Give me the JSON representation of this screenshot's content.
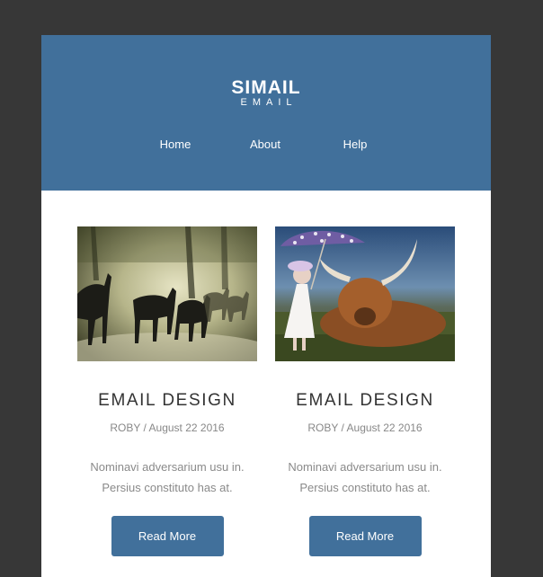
{
  "brand": {
    "title": "SIMAIL",
    "subtitle": "EMAIL"
  },
  "nav": [
    {
      "label": "Home"
    },
    {
      "label": "About"
    },
    {
      "label": "Help"
    }
  ],
  "posts": [
    {
      "image": "horses-running-in-dust-photo",
      "title": "EMAIL DESIGN",
      "meta": "ROBY / August 22 2016",
      "excerpt_line1": "Nominavi adversarium usu in.",
      "excerpt_line2": "Persius constituto has at.",
      "button": "Read More"
    },
    {
      "image": "girl-with-umbrella-and-highland-cow-photo",
      "title": "EMAIL DESIGN",
      "meta": "ROBY / August 22 2016",
      "excerpt_line1": "Nominavi adversarium usu in.",
      "excerpt_line2": "Persius constituto has at.",
      "button": "Read More"
    }
  ],
  "colors": {
    "header": "#41709b",
    "button": "#41709b",
    "page_bg": "#373737"
  }
}
